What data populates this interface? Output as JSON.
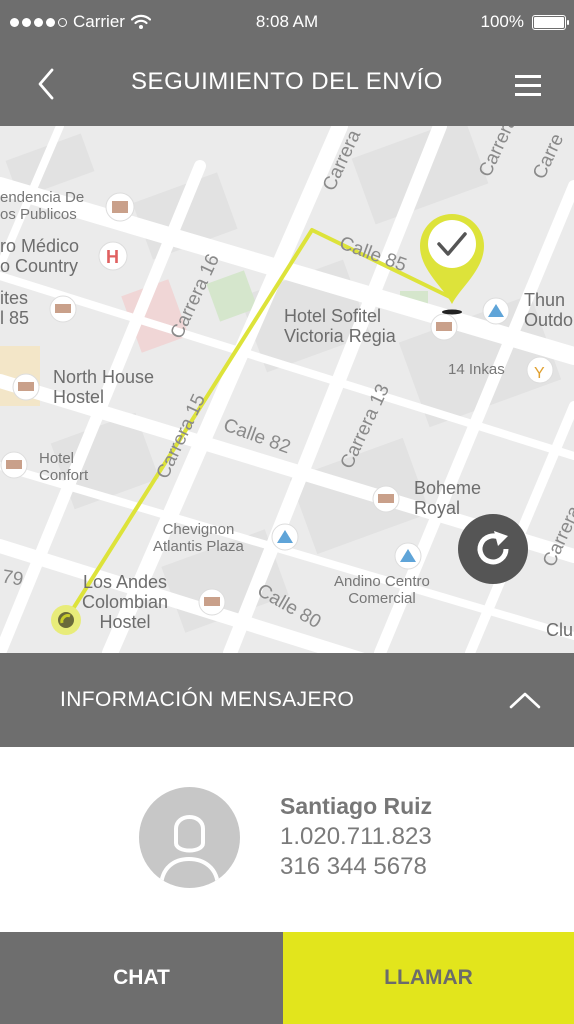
{
  "status_bar": {
    "carrier": "Carrier",
    "time": "8:08 AM",
    "battery": "100%",
    "signal_bars": 4,
    "signal_total": 5
  },
  "header": {
    "title": "SEGUIMIENTO DEL ENVÍO",
    "back_icon": "chevron-left-icon",
    "menu_icon": "hamburger-menu-icon"
  },
  "map": {
    "places": {
      "p1": "endencia De\nos Publicos",
      "p2": "ro Médico\no Country",
      "p3": "ites\nl 85",
      "p4": "North House\nHostel",
      "p5": "Hotel\nConfort",
      "p6": "Hotel Sofitel\nVictoria Regia",
      "p7": "14 Inkas",
      "p8": "Thun\nOutdo",
      "p9": "Boheme\nRoyal",
      "p10": "Chevignon\nAtlantis Plaza",
      "p11": "Andino Centro\nComercial",
      "p12": "Los Andes\nColombian\nHostel",
      "p13": "Clu"
    },
    "streets": {
      "s1": "Calle 85",
      "s2": "Carrera 16",
      "s3": "Carrera 15",
      "s4": "Calle 82",
      "s5": "Carrera 13",
      "s6": "Calle 80",
      "s7": "Carrera",
      "s8": "Carrera",
      "s9": "Carre",
      "s10": "79"
    },
    "route_color": "#dde33a",
    "destination_icon": "checkmark-pin-icon",
    "origin_icon": "location-dot-icon",
    "refresh_icon": "refresh-icon"
  },
  "info_section": {
    "title": "INFORMACIÓN MENSAJERO",
    "toggle_icon": "chevron-up-icon"
  },
  "courier": {
    "name": "Santiago Ruiz",
    "id_number": "1.020.711.823",
    "phone": "316 344 5678",
    "avatar_icon": "user-avatar-icon"
  },
  "actions": {
    "chat_label": "CHAT",
    "call_label": "LLAMAR"
  },
  "colors": {
    "primary_gray": "#6e6e6e",
    "accent_yellow": "#e2e51c"
  }
}
